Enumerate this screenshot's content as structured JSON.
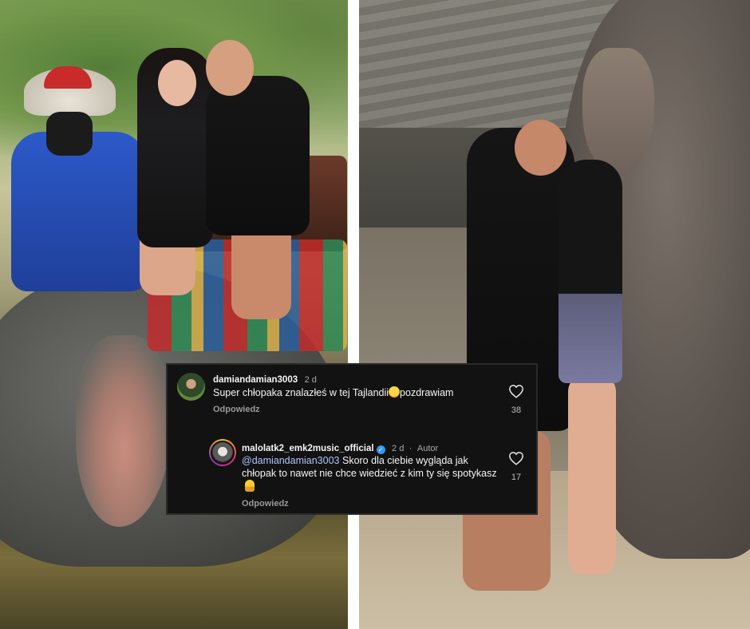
{
  "comments": [
    {
      "username": "damiandamian3003",
      "time": "2 d",
      "text": "Super chłopaka znalazłeś w tej Tajlandii",
      "text_after_emoji": "pozdrawiam",
      "emoji_icon": "rolling-laughing-emoji-icon",
      "reply_label": "Odpowiedz",
      "likes": "38"
    },
    {
      "username": "malolatk2_emk2music_official",
      "verified": true,
      "time": "2 d",
      "separator": "·",
      "author_label": "Autor",
      "mention": "@damiandamian3003",
      "text": "Skoro dla ciebie wygląda jak chłopak to nawet nie chce wiedzieć z kim ty się spotykasz",
      "emoji_icon": "person-emoji-icon",
      "reply_label": "Odpowiedz",
      "likes": "17"
    }
  ],
  "icons": {
    "like": "heart-outline-icon",
    "verified": "verified-badge-icon"
  },
  "colors": {
    "card_background": "#121212",
    "text_primary": "#f5f5f5",
    "text_secondary": "#a8a8a8",
    "mention": "#a9c8ff",
    "verified_badge": "#3897f0"
  }
}
